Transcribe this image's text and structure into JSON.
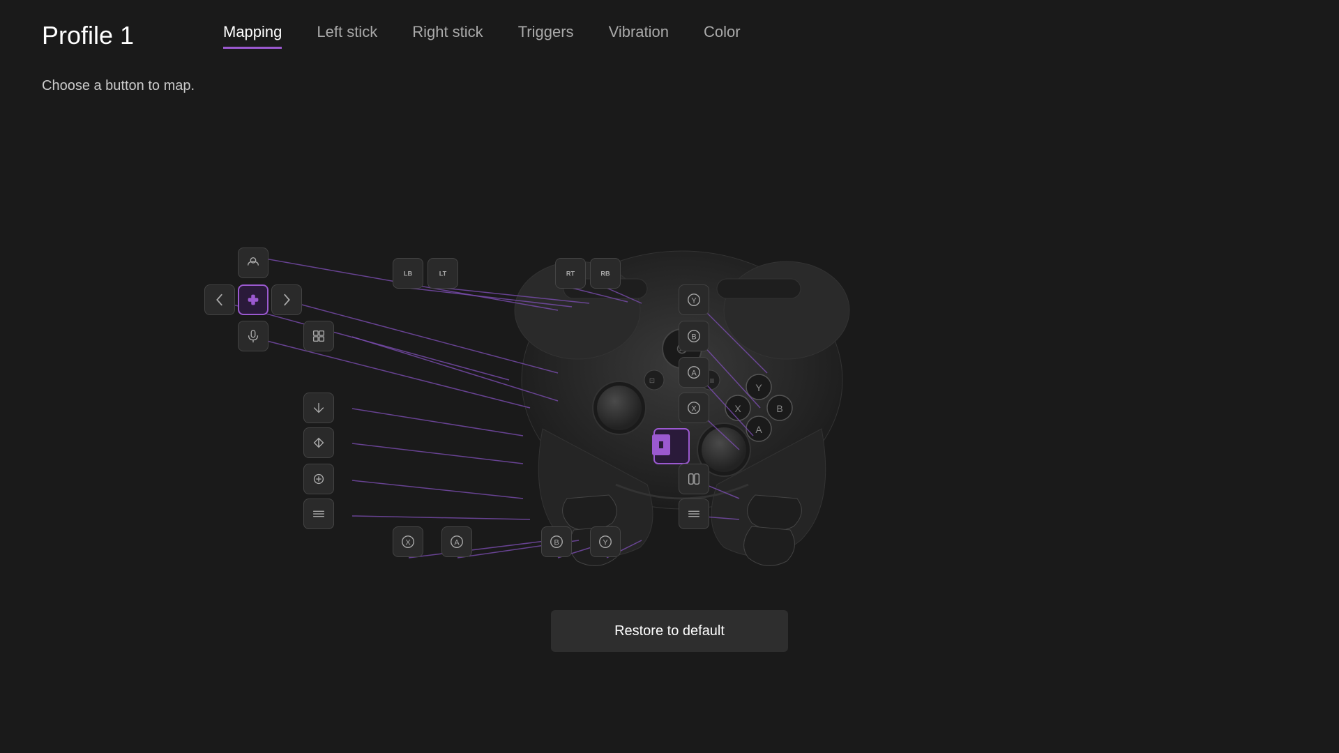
{
  "header": {
    "profile_title": "Profile 1",
    "tabs": [
      {
        "id": "mapping",
        "label": "Mapping",
        "active": true
      },
      {
        "id": "left-stick",
        "label": "Left stick",
        "active": false
      },
      {
        "id": "right-stick",
        "label": "Right stick",
        "active": false
      },
      {
        "id": "triggers",
        "label": "Triggers",
        "active": false
      },
      {
        "id": "vibration",
        "label": "Vibration",
        "active": false
      },
      {
        "id": "color",
        "label": "Color",
        "active": false
      }
    ]
  },
  "subtitle": "Choose a button to map.",
  "restore_button": "Restore to default",
  "buttons": {
    "lb": "LB",
    "lt": "LT",
    "rt": "RT",
    "rb": "RB",
    "y": "Y",
    "b": "B",
    "a": "A",
    "x": "X",
    "paddle_x": "X",
    "paddle_a": "A",
    "paddle_b": "B",
    "paddle_y": "Y"
  },
  "colors": {
    "bg": "#1a1a1a",
    "active_tab_underline": "#9b59d0",
    "active_btn_border": "#9b59d0",
    "active_btn_bg": "#2a1a3a",
    "connector_line": "#7b4db0",
    "btn_bg": "#2a2a2a",
    "btn_border": "#444444"
  }
}
